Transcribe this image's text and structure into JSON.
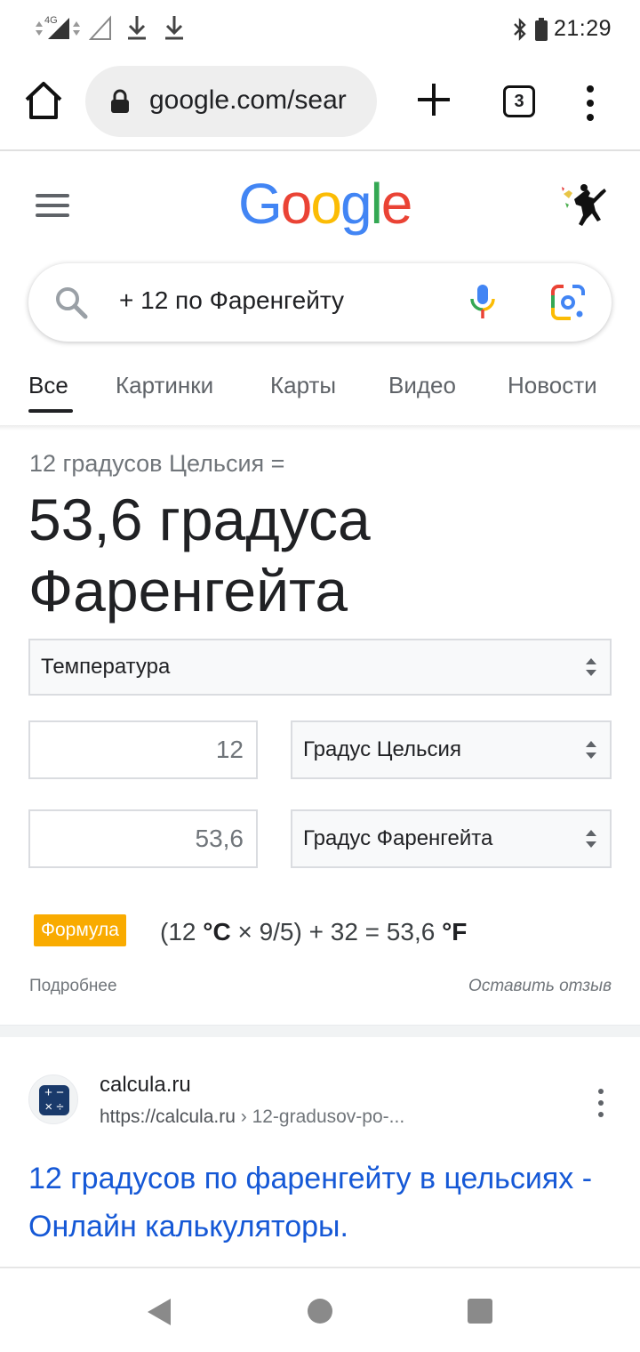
{
  "status_bar": {
    "network": "4G",
    "time": "21:29"
  },
  "browser": {
    "url": "google.com/sear",
    "tab_count": "3"
  },
  "google": {
    "logo_letters": [
      {
        "ch": "G",
        "color": "#4285F4"
      },
      {
        "ch": "o",
        "color": "#EA4335"
      },
      {
        "ch": "o",
        "color": "#FBBC05"
      },
      {
        "ch": "g",
        "color": "#4285F4"
      },
      {
        "ch": "l",
        "color": "#34A853"
      },
      {
        "ch": "e",
        "color": "#EA4335"
      }
    ],
    "search_query": "+ 12 по Фаренгейту"
  },
  "tabs": [
    {
      "label": "Все",
      "active": true
    },
    {
      "label": "Картинки",
      "active": false
    },
    {
      "label": "Карты",
      "active": false
    },
    {
      "label": "Видео",
      "active": false
    },
    {
      "label": "Новости",
      "active": false
    }
  ],
  "converter": {
    "subtitle": "12 градусов Цельсия =",
    "result_line1": "53,6 градуса",
    "result_line2": "Фаренгейта",
    "unit_type": "Температура",
    "from_value": "12",
    "from_unit": "Градус Цельсия",
    "to_value": "53,6",
    "to_unit": "Градус Фаренгейта",
    "formula_label": "Формула",
    "formula_prefix": "(12 ",
    "formula_unit_c": "°C",
    "formula_mid": " × 9/5) + 32 = 53,6 ",
    "formula_unit_f": "°F",
    "more_link": "Подробнее",
    "feedback_link": "Оставить отзыв"
  },
  "result": {
    "site_name": "calcula.ru",
    "url": "https://calcula.ru",
    "url_crumb": " › 12-gradusov-po-...",
    "title": "12 градусов по фаренгейту в цельсиях - Онлайн калькуляторы."
  },
  "colors": {
    "link": "#1558d6",
    "badge": "#f9ab00",
    "accent_blue": "#4285F4"
  }
}
